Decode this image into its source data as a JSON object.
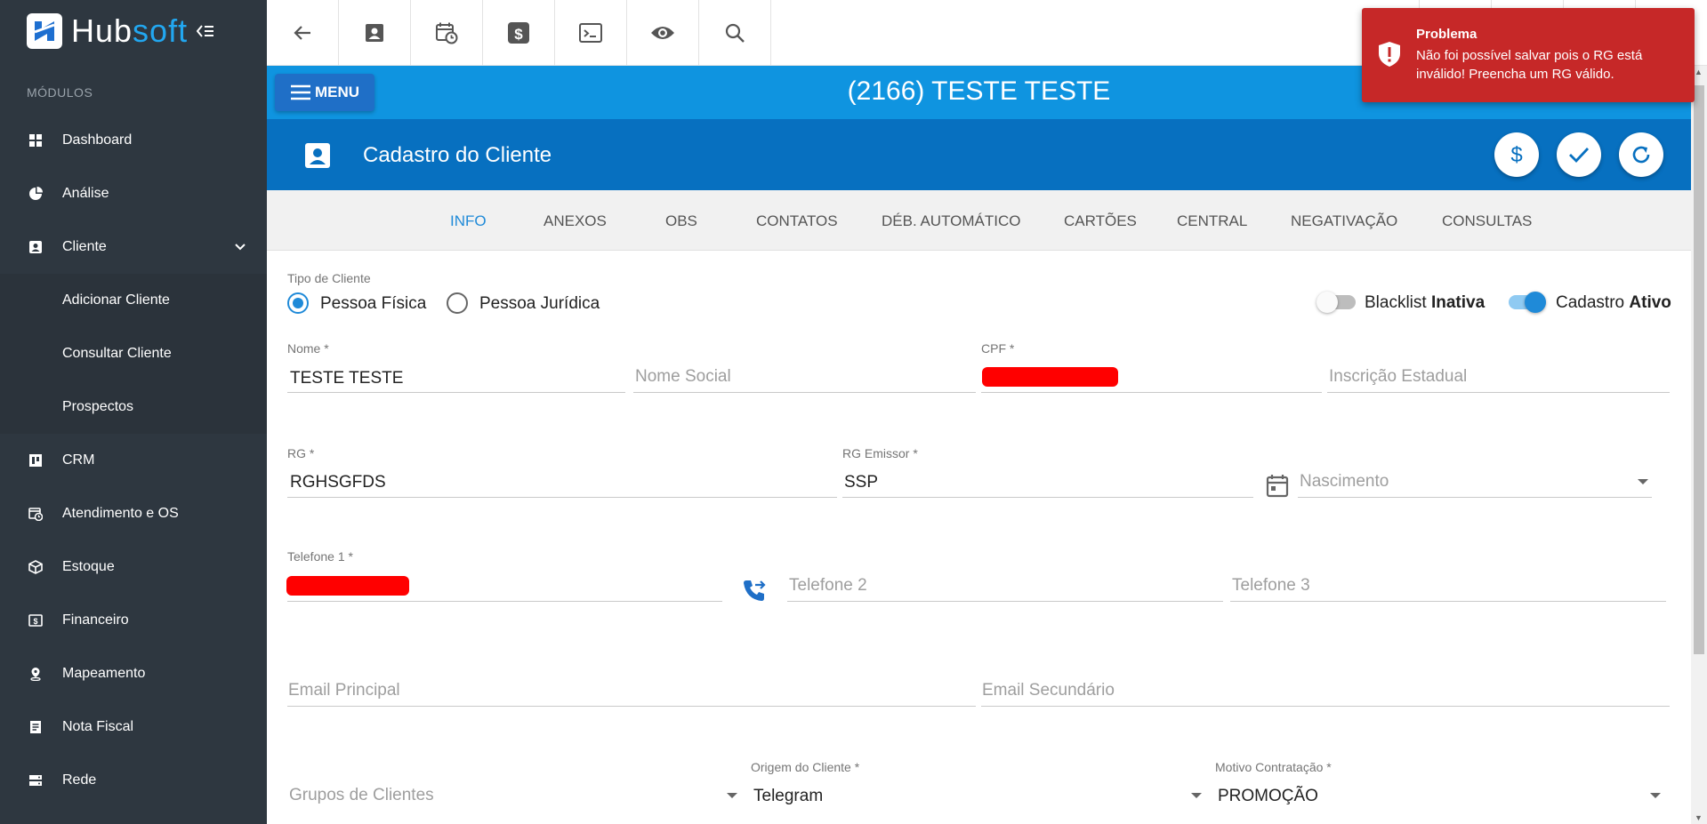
{
  "brand": {
    "name_part1": "Hub",
    "name_part2": "soft"
  },
  "sidebar": {
    "header": "MÓDULOS",
    "items": [
      {
        "label": "Dashboard",
        "icon": "dashboard-icon"
      },
      {
        "label": "Análise",
        "icon": "pie-chart-icon"
      },
      {
        "label": "Cliente",
        "icon": "contact-card-icon"
      },
      {
        "label": "CRM",
        "icon": "kanban-icon"
      },
      {
        "label": "Atendimento e OS",
        "icon": "calendar-clock-icon"
      },
      {
        "label": "Estoque",
        "icon": "box-icon"
      },
      {
        "label": "Financeiro",
        "icon": "money-icon"
      },
      {
        "label": "Mapeamento",
        "icon": "map-pin-icon"
      },
      {
        "label": "Nota Fiscal",
        "icon": "receipt-icon"
      },
      {
        "label": "Rede",
        "icon": "server-icon"
      }
    ],
    "cliente_subitems": [
      "Adicionar Cliente",
      "Consultar Cliente",
      "Prospectos"
    ]
  },
  "toolbar": {
    "icons": [
      "back-arrow-icon",
      "contact-card-icon",
      "calendar-clock-icon",
      "dollar-icon",
      "terminal-icon",
      "eye-icon",
      "search-icon"
    ]
  },
  "header": {
    "menu_label": "MENU",
    "client_title": "(2166) TESTE TESTE",
    "section_title": "Cadastro do Cliente"
  },
  "tabs": [
    "INFO",
    "ANEXOS",
    "OBS",
    "CONTATOS",
    "DÉB. AUTOMÁTICO",
    "CARTÕES",
    "CENTRAL",
    "NEGATIVAÇÃO",
    "CONSULTAS"
  ],
  "active_tab": "INFO",
  "form": {
    "tipo_label": "Tipo de Cliente",
    "pessoa_fisica": "Pessoa Física",
    "pessoa_juridica": "Pessoa Jurídica",
    "selected_tipo": "Pessoa Física",
    "blacklist_label": "Blacklist",
    "blacklist_state": "Inativa",
    "cadastro_label": "Cadastro",
    "cadastro_state": "Ativo",
    "nome_label": "Nome *",
    "nome_value": "TESTE TESTE",
    "nome_social_placeholder": "Nome Social",
    "cpf_label": "CPF *",
    "inscricao_placeholder": "Inscrição Estadual",
    "rg_label": "RG *",
    "rg_value": "RGHSGFDS",
    "rg_emissor_label": "RG Emissor *",
    "rg_emissor_value": "SSP",
    "nascimento_placeholder": "Nascimento",
    "telefone1_label": "Telefone 1 *",
    "telefone2_placeholder": "Telefone 2",
    "telefone3_placeholder": "Telefone 3",
    "email_principal_placeholder": "Email Principal",
    "email_secundario_placeholder": "Email Secundário",
    "grupos_placeholder": "Grupos de Clientes",
    "origem_label": "Origem do Cliente *",
    "origem_value": "Telegram",
    "motivo_label": "Motivo Contratação *",
    "motivo_value": "PROMOÇÃO"
  },
  "toast": {
    "title": "Problema",
    "message": "Não foi possível salvar pois o RG está inválido! Preencha um RG válido."
  },
  "colors": {
    "sidebar": "#2e3740",
    "header_blue": "#0f94e0",
    "section_blue": "#0770c0",
    "accent": "#1f8ad8",
    "toast": "#c62828",
    "redaction": "#ff0000"
  }
}
